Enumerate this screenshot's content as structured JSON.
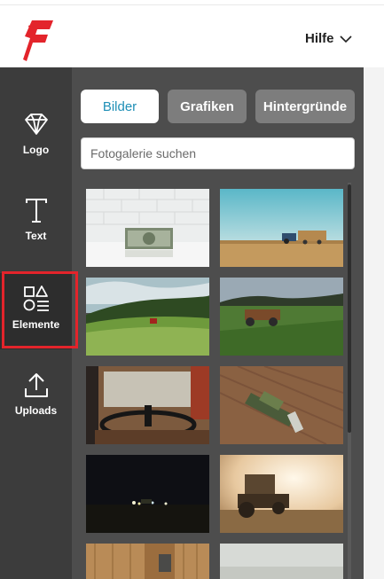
{
  "header": {
    "help_label": "Hilfe"
  },
  "sidebar": {
    "items": [
      {
        "label": "Logo",
        "icon": "diamond-icon"
      },
      {
        "label": "Text",
        "icon": "text-t-icon"
      },
      {
        "label": "Elemente",
        "icon": "shapes-icon",
        "active": true
      },
      {
        "label": "Uploads",
        "icon": "upload-icon"
      }
    ]
  },
  "panel": {
    "tabs": [
      {
        "label": "Bilder",
        "active": true
      },
      {
        "label": "Grafiken",
        "active": false
      },
      {
        "label": "Hintergründe",
        "active": false
      }
    ],
    "search_placeholder": "Fotogalerie suchen",
    "photos": [
      "dollar-bill-on-white-brick",
      "tractor-with-hay-trailer-on-field",
      "green-hill-field-with-tractor",
      "old-tractor-in-green-meadow",
      "tractor-cab-steering-wheel",
      "aerial-combine-harvester",
      "night-field-with-lights",
      "tractor-in-dusty-sunset",
      "aerial-harvester-strip-field",
      "foggy-field"
    ]
  },
  "colors": {
    "brand_red": "#e3242b",
    "sidebar_bg": "#3c3c3c",
    "panel_bg": "#4d4d4d",
    "tab_active_text": "#1f8fb6",
    "tab_inactive_bg": "#7d7d7d"
  }
}
